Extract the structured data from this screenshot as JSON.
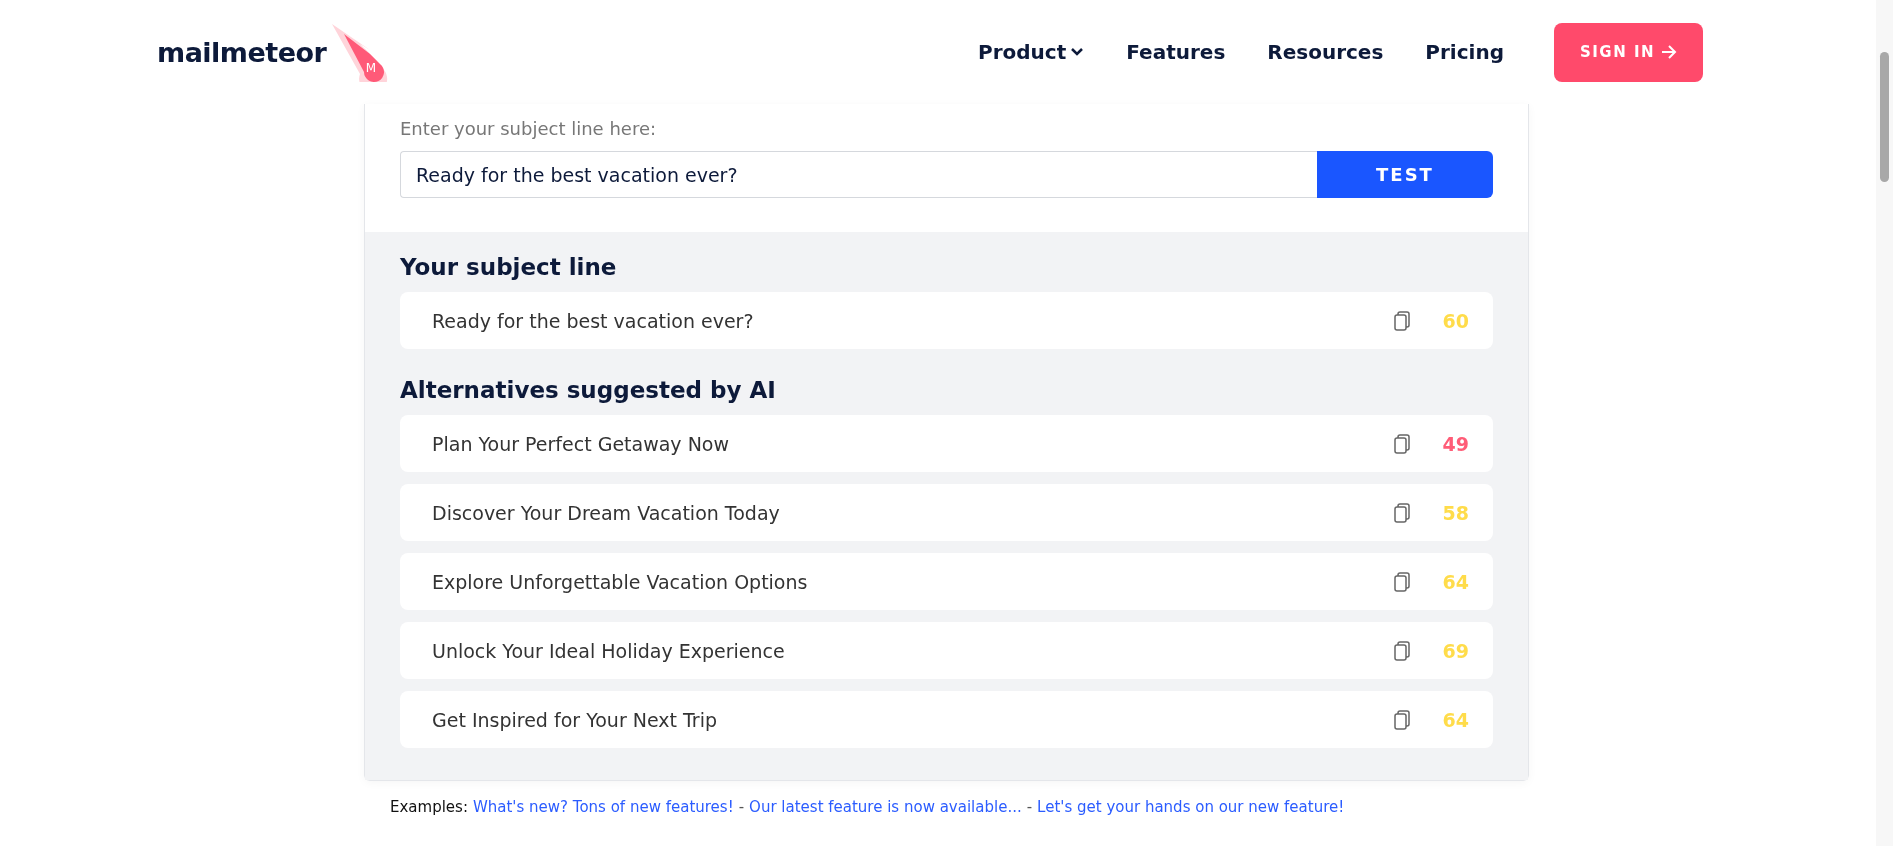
{
  "header": {
    "logo": "mailmeteor",
    "logo_mark": "M",
    "nav": [
      {
        "label": "Product",
        "kind": "dropdown"
      },
      {
        "label": "Features",
        "kind": "link"
      },
      {
        "label": "Resources",
        "kind": "link"
      },
      {
        "label": "Pricing",
        "kind": "link"
      }
    ],
    "sign_in": "SIGN IN"
  },
  "tester": {
    "label": "Enter your subject line here:",
    "value": "Ready for the best vacation ever?",
    "button": "TEST"
  },
  "results": {
    "subject_title": "Your subject line",
    "subject": {
      "text": "Ready for the best vacation ever?",
      "score": "60",
      "color": "#ffdc4a"
    },
    "alternatives_title": "Alternatives suggested by AI",
    "alternatives": [
      {
        "text": "Plan Your Perfect Getaway Now",
        "score": "49",
        "color": "#ff5c77"
      },
      {
        "text": "Discover Your Dream Vacation Today",
        "score": "58",
        "color": "#ffdc4a"
      },
      {
        "text": "Explore Unforgettable Vacation Options",
        "score": "64",
        "color": "#ffdc4a"
      },
      {
        "text": "Unlock Your Ideal Holiday Experience",
        "score": "69",
        "color": "#ffdc4a"
      },
      {
        "text": "Get Inspired for Your Next Trip",
        "score": "64",
        "color": "#ffdc4a"
      }
    ]
  },
  "examples": {
    "label": "Examples:",
    "items": [
      {
        "kind": "link",
        "text": "What's new? Tons of new features!"
      },
      {
        "kind": "separator",
        "text": "-"
      },
      {
        "kind": "link",
        "text": "Our latest feature is now available..."
      },
      {
        "kind": "separator",
        "text": "-"
      },
      {
        "kind": "link",
        "text": "Let's get your hands on our new feature!"
      }
    ]
  }
}
